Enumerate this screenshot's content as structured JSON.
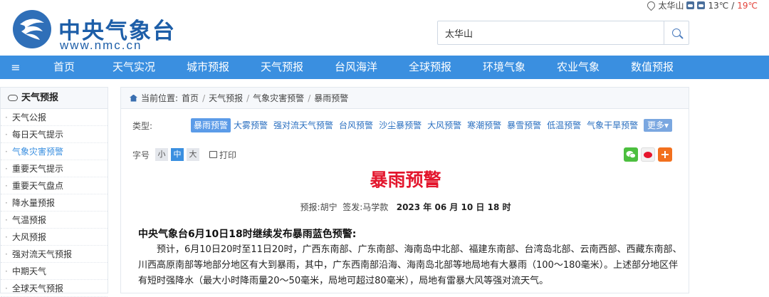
{
  "brand": {
    "name_cn": "中央气象台",
    "url": "www.nmc.cn",
    "logo_icon": "nmc-logo-icon"
  },
  "top_weather": {
    "location": "太华山",
    "temp_low": "13℃",
    "separator": "/",
    "temp_high": "19℃",
    "location_icon": "location-pin-icon",
    "weather_icons": [
      "partly-cloudy-icon",
      "cloudy-icon"
    ]
  },
  "search": {
    "value": "太华山",
    "icon": "search-icon"
  },
  "nav": {
    "menu_icon": "≡",
    "items": [
      "首页",
      "天气实况",
      "城市预报",
      "天气预报",
      "台风海洋",
      "全球预报",
      "环境气象",
      "农业气象",
      "数值预报"
    ]
  },
  "sidebar": {
    "title": "天气预报",
    "title_icon": "cloud-icon",
    "items": [
      "天气公报",
      "每日天气提示",
      "气象灾害预警",
      "重要天气提示",
      "重要天气盘点",
      "降水量预报",
      "气温预报",
      "大风预报",
      "强对流天气预报",
      "中期天气",
      "全球天气预报"
    ],
    "active_index": 2
  },
  "breadcrumb": {
    "prefix": "当前位置:",
    "items": [
      "首页",
      "天气预报",
      "气象灾害预警",
      "暴雨预警"
    ],
    "separator": "/"
  },
  "types": {
    "label": "类型:",
    "items": [
      "暴雨预警",
      "大雾预警",
      "强对流天气预警",
      "台风预警",
      "沙尘暴预警",
      "大风预警",
      "寒潮预警",
      "暴雪预警",
      "低温预警",
      "气象干旱预警"
    ],
    "active_index": 0,
    "more": "更多▾"
  },
  "tools": {
    "font_label": "字号",
    "font_sizes": [
      "小",
      "中",
      "大"
    ],
    "active_font": 1,
    "print": "打印",
    "share_icons": [
      "wechat-icon",
      "weibo-icon",
      "plus-share-icon"
    ]
  },
  "article": {
    "title": "暴雨预警",
    "byline_issuer_label": "预报:",
    "byline_issuer": "胡宁",
    "byline_signer_label": "签发:",
    "byline_signer": "马学款",
    "byline_date": "2023 年 06 月 10 日 18 时",
    "headline": "中央气象台6月10日18时继续发布暴雨蓝色预警:",
    "paragraph": "预计，6月10日20时至11日20时，广西东南部、广东南部、海南岛中北部、福建东南部、台湾岛北部、云南西部、西藏东南部、川西高原南部等地部分地区有大到暴雨，其中，广东西南部沿海、海南岛北部等地局地有大暴雨（100～180毫米）。上述部分地区伴有短时强降水（最大小时降雨量20～50毫米，局地可超过80毫米），局地有雷暴大风等强对流天气。"
  }
}
